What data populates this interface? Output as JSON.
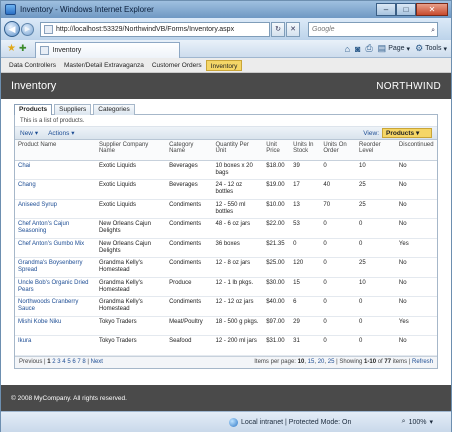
{
  "window": {
    "title": "Inventory - Windows Internet Explorer",
    "min": "–",
    "max": "□",
    "close": "✕"
  },
  "address": {
    "url": "http://localhost:53329/NorthwindVB/Forms/Inventory.aspx",
    "search_placeholder": "Google"
  },
  "browser_tab": {
    "label": "Inventory"
  },
  "command_bar": {
    "page": "Page",
    "tools": "Tools"
  },
  "menu": [
    "Data Controllers",
    "Master/Detail Extravaganza",
    "Customer Orders",
    "Inventory"
  ],
  "page": {
    "title": "Inventory",
    "brand": "NORTHWIND"
  },
  "tabs": [
    "Products",
    "Suppliers",
    "Categories"
  ],
  "description": "This is a list of products.",
  "actions": {
    "new": "New",
    "actions": "Actions",
    "view_label": "View:",
    "view_value": "Products"
  },
  "columns": [
    "Product Name",
    "Supplier Company Name",
    "Category Name",
    "Quantity Per Unit",
    "Unit Price",
    "Units In Stock",
    "Units On Order",
    "Reorder Level",
    "Discontinued"
  ],
  "rows": [
    [
      "Chai",
      "Exotic Liquids",
      "Beverages",
      "10 boxes x 20 bags",
      "$18.00",
      "39",
      "0",
      "10",
      "No"
    ],
    [
      "Chang",
      "Exotic Liquids",
      "Beverages",
      "24 - 12 oz bottles",
      "$19.00",
      "17",
      "40",
      "25",
      "No"
    ],
    [
      "Aniseed Syrup",
      "Exotic Liquids",
      "Condiments",
      "12 - 550 ml bottles",
      "$10.00",
      "13",
      "70",
      "25",
      "No"
    ],
    [
      "Chef Anton's Cajun Seasoning",
      "New Orleans Cajun Delights",
      "Condiments",
      "48 - 6 oz jars",
      "$22.00",
      "53",
      "0",
      "0",
      "No"
    ],
    [
      "Chef Anton's Gumbo Mix",
      "New Orleans Cajun Delights",
      "Condiments",
      "36 boxes",
      "$21.35",
      "0",
      "0",
      "0",
      "Yes"
    ],
    [
      "Grandma's Boysenberry Spread",
      "Grandma Kelly's Homestead",
      "Condiments",
      "12 - 8 oz jars",
      "$25.00",
      "120",
      "0",
      "25",
      "No"
    ],
    [
      "Uncle Bob's Organic Dried Pears",
      "Grandma Kelly's Homestead",
      "Produce",
      "12 - 1 lb pkgs.",
      "$30.00",
      "15",
      "0",
      "10",
      "No"
    ],
    [
      "Northwoods Cranberry Sauce",
      "Grandma Kelly's Homestead",
      "Condiments",
      "12 - 12 oz jars",
      "$40.00",
      "6",
      "0",
      "0",
      "No"
    ],
    [
      "Mishi Kobe Niku",
      "Tokyo Traders",
      "Meat/Poultry",
      "18 - 500 g pkgs.",
      "$97.00",
      "29",
      "0",
      "0",
      "Yes"
    ],
    [
      "Ikura",
      "Tokyo Traders",
      "Seafood",
      "12 - 200 ml jars",
      "$31.00",
      "31",
      "0",
      "0",
      "No"
    ]
  ],
  "pager": {
    "previous": "Previous",
    "pages": [
      "1",
      "2",
      "3",
      "4",
      "5",
      "6",
      "7",
      "8"
    ],
    "current": "1",
    "next": "Next",
    "items_per_page_label": "Items per page:",
    "sizes": [
      "10",
      "15",
      "20",
      "25"
    ],
    "showing_prefix": "| Showing",
    "showing_range": "1-10",
    "of": "of",
    "total": "77",
    "items": "items |",
    "refresh": "Refresh"
  },
  "footer": "© 2008 MyCompany. All rights reserved.",
  "status": {
    "zone": "Local intranet | Protected Mode: On",
    "zoom": "100%"
  }
}
